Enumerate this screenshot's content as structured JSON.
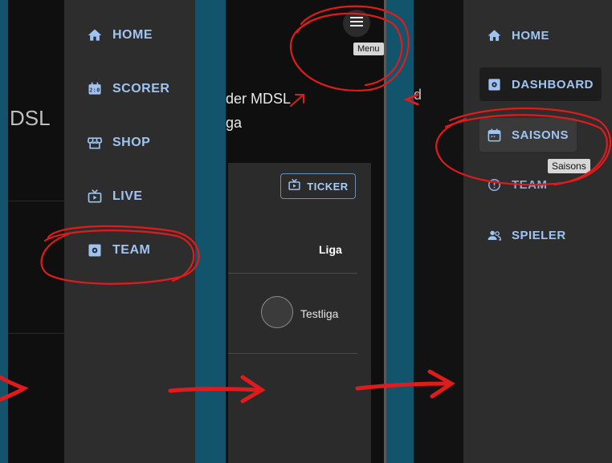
{
  "panel1": {
    "background_fragment": "DSL",
    "nav": [
      {
        "label": "HOME",
        "icon": "home-icon"
      },
      {
        "label": "SCORER",
        "icon": "scoreboard-icon"
      },
      {
        "label": "SHOP",
        "icon": "storefront-icon"
      },
      {
        "label": "LIVE",
        "icon": "live-tv-icon"
      },
      {
        "label": "TEAM",
        "icon": "team-settings-icon"
      }
    ]
  },
  "panel2": {
    "title_line1": "der MDSL",
    "title_line2": "ga",
    "menu_tooltip": "Menu",
    "ticker_label": "TICKER",
    "column_header": "Liga",
    "row_name": "Testliga"
  },
  "panel3": {
    "background_fragment": "d",
    "nav": [
      {
        "label": "HOME",
        "icon": "home-icon"
      },
      {
        "label": "DASHBOARD",
        "icon": "dashboard-icon"
      },
      {
        "label": "SAISONS",
        "icon": "calendar-icon"
      },
      {
        "label": "TEAM",
        "icon": "team-icon"
      },
      {
        "label": "SPIELER",
        "icon": "players-icon"
      }
    ],
    "saisons_tooltip": "Saisons"
  },
  "colors": {
    "page_background": "#12546c",
    "drawer": "#2d2d2d",
    "nav_text": "#9fc4f2",
    "annotation": "#e01b1b"
  }
}
